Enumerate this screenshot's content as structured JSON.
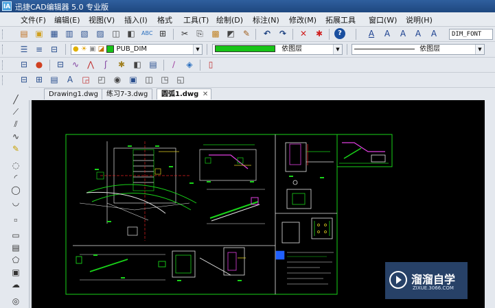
{
  "window": {
    "app_icon": "IA",
    "title": "迅捷CAD编辑器 5.0 专业版"
  },
  "menu": {
    "items": [
      "文件(F)",
      "编辑(E)",
      "视图(V)",
      "插入(I)",
      "格式",
      "工具(T)",
      "绘制(D)",
      "标注(N)",
      "修改(M)",
      "拓展工具",
      "窗口(W)",
      "说明(H)"
    ]
  },
  "toolbar1": {
    "icons": [
      "new-icon",
      "open-icon",
      "save-icon",
      "print-preview-icon",
      "plot-icon",
      "print-icon",
      "page-setup-icon",
      "publish-icon",
      "spell-check-icon",
      "find-icon",
      "cut-icon",
      "copy-icon",
      "paste-icon",
      "match-prop-icon",
      "brush-icon",
      "undo-icon",
      "redo-icon",
      "delete-icon",
      "explode-icon",
      "help-icon",
      "text-icon",
      "text-style-icon",
      "edit-text-icon",
      "spell-text-icon",
      "scale-text-icon"
    ],
    "text_style_value": "DIM_FONT"
  },
  "toolbar2": {
    "layer_value": "PUB_DIM",
    "color_value": "依图层",
    "linetype_value": "依图层",
    "layer_color": "#17c417"
  },
  "tabs": [
    {
      "label": "Drawing1.dwg",
      "active": false
    },
    {
      "label": "练习7-3.dwg",
      "active": false
    },
    {
      "label": "圆弧1.dwg",
      "active": true
    }
  ],
  "watermark": {
    "name": "溜溜自学",
    "url": "ZIXUE.3066.COM"
  },
  "colors": {
    "canvas_bg": "#000000",
    "drawing_green": "#19d419",
    "drawing_white": "#e6e6e6",
    "drawing_magenta": "#e040e0",
    "drawing_red": "#e02020",
    "drawing_yellow": "#e0d020",
    "drawing_cyan": "#20c8e0"
  }
}
